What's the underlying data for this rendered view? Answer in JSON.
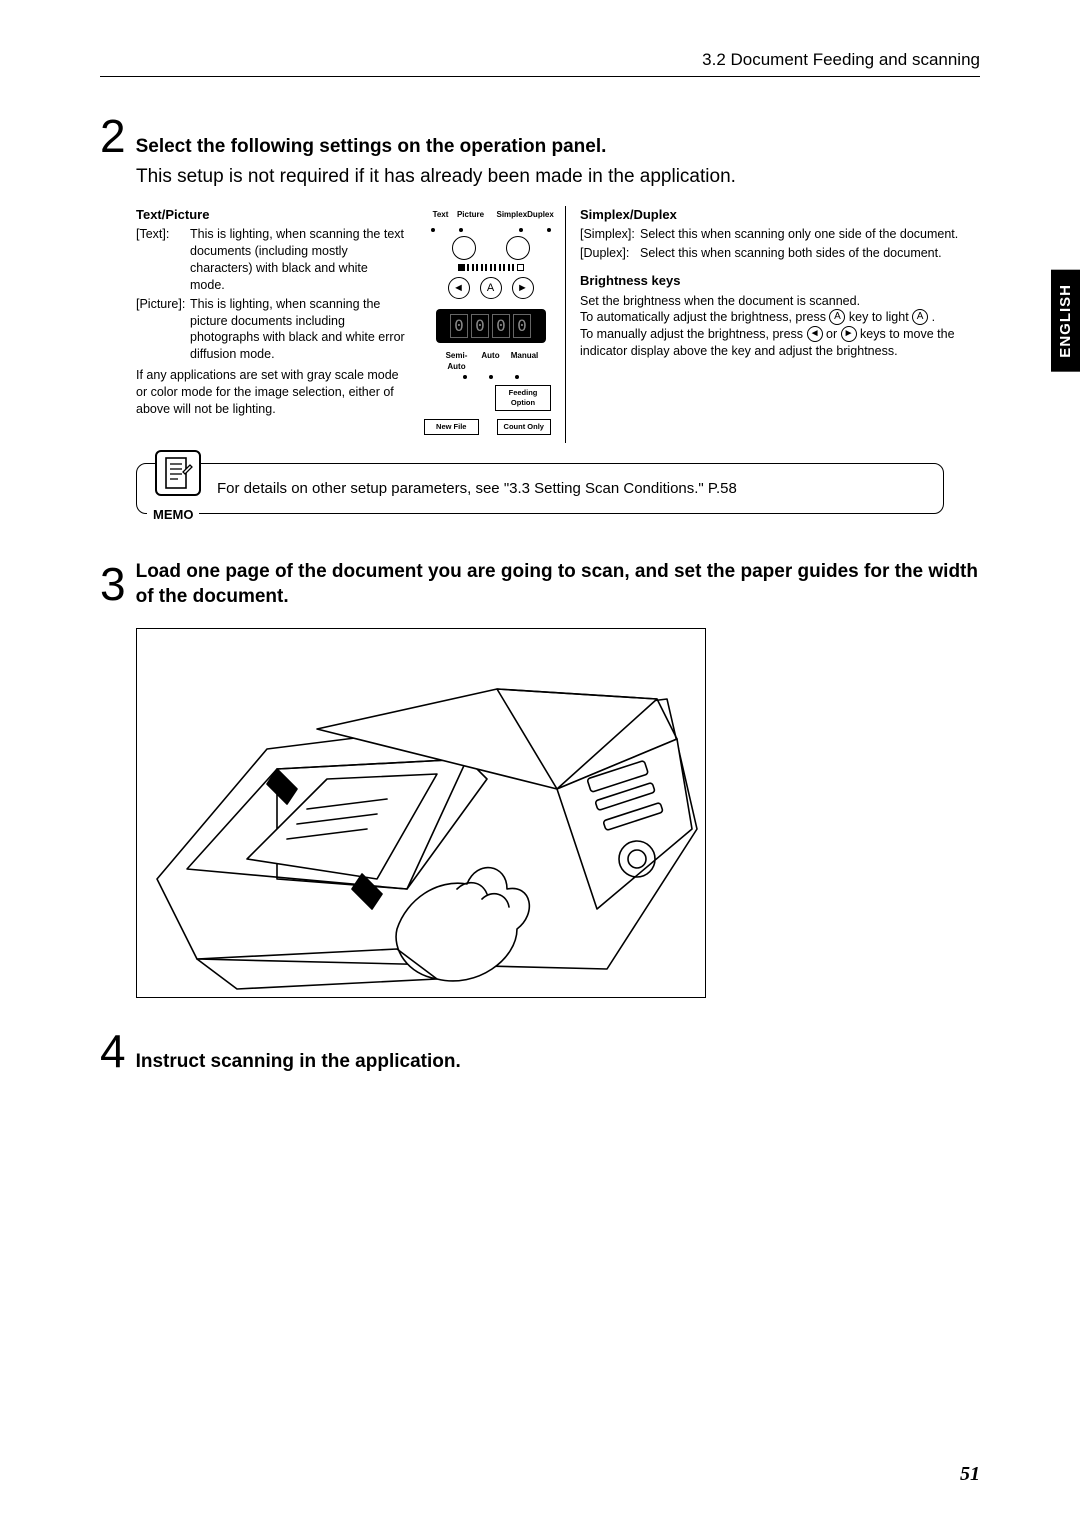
{
  "header": {
    "section": "3.2   Document Feeding and scanning"
  },
  "side_tab": "ENGLISH",
  "step2": {
    "num": "2",
    "title": "Select the following settings on the operation panel.",
    "sub": "This setup is not required if it has already been made in the application."
  },
  "text_picture": {
    "heading": "Text/Picture",
    "text_key": "[Text]:",
    "text_val": "This is lighting, when scanning the text documents (including mostly characters) with black and white mode.",
    "picture_key": "[Picture]:",
    "picture_val": "This is lighting, when scanning the picture documents including photographs with black and white error diffusion mode.",
    "note": "If any applications are set with gray scale mode or color mode for the image selection, either of above will not be lighting."
  },
  "cp_labels": {
    "text": "Text",
    "picture": "Picture",
    "simplex": "Simplex",
    "duplex": "Duplex",
    "semi_auto": "Semi-Auto",
    "auto": "Auto",
    "manual": "Manual",
    "feeding": "Feeding Option",
    "new_file": "New File",
    "count_only": "Count Only",
    "disp": "0000"
  },
  "simplex_duplex": {
    "heading": "Simplex/Duplex",
    "s_key": "[Simplex]:",
    "s_val": "Select this when scanning only one side of the document.",
    "d_key": "[Duplex]:",
    "d_val": "Select this when scanning both sides of the document."
  },
  "brightness": {
    "heading": "Brightness keys",
    "l1": "Set the brightness when the document is scanned.",
    "l2a": "To automatically adjust the brightness, press ",
    "l2b": " key to light ",
    "l2c": " .",
    "l3a": "To manually adjust the brightness, press ",
    "l3b": " or ",
    "l3c": " keys to move the indicator display above the key and adjust the brightness.",
    "A": "A",
    "left": "◄",
    "right": "►"
  },
  "memo": {
    "label": "MEMO",
    "text": "For details on other setup parameters, see \"3.3 Setting Scan Conditions.\" P.58"
  },
  "step3": {
    "num": "3",
    "title": "Load one page of the document you are going to scan, and set the paper guides for the width of the document."
  },
  "step4": {
    "num": "4",
    "title": "Instruct scanning in the application."
  },
  "page_num": "51"
}
